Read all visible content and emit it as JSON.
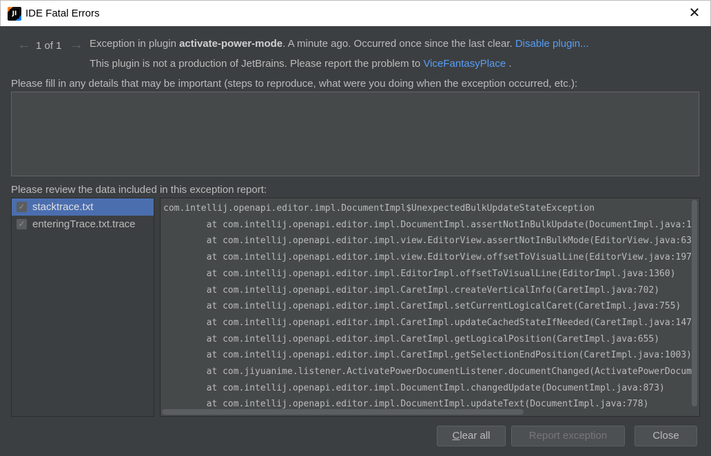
{
  "window": {
    "title": "IDE Fatal Errors",
    "app_icon_text": "JI",
    "close_glyph": "✕"
  },
  "nav": {
    "prev_glyph": "←",
    "next_glyph": "→",
    "counter": "1 of 1"
  },
  "header": {
    "prefix": "Exception in plugin",
    "plugin_name": "activate-power-mode",
    "suffix": ". A minute ago. Occurred once since the last clear.",
    "disable_link": "Disable plugin...",
    "line2_prefix": "This plugin is not a production of JetBrains. Please report the problem to",
    "vendor_link": "ViceFantasyPlace",
    "line2_suffix": "."
  },
  "details": {
    "label": "Please fill in any details that may be important (steps to reproduce, what were you doing when the exception occurred, etc.):",
    "value": ""
  },
  "review": {
    "label": "Please review the data included in this exception report:",
    "files": [
      {
        "name": "stacktrace.txt",
        "checked": true,
        "selected": true
      },
      {
        "name": "enteringTrace.txt.trace",
        "checked": true,
        "selected": false
      }
    ],
    "trace_lines": [
      "com.intellij.openapi.editor.impl.DocumentImpl$UnexpectedBulkUpdateStateException",
      "\tat com.intellij.openapi.editor.impl.DocumentImpl.assertNotInBulkUpdate(DocumentImpl.java:1",
      "\tat com.intellij.openapi.editor.impl.view.EditorView.assertNotInBulkMode(EditorView.java:63",
      "\tat com.intellij.openapi.editor.impl.view.EditorView.offsetToVisualLine(EditorView.java:197",
      "\tat com.intellij.openapi.editor.impl.EditorImpl.offsetToVisualLine(EditorImpl.java:1360)",
      "\tat com.intellij.openapi.editor.impl.CaretImpl.createVerticalInfo(CaretImpl.java:702)",
      "\tat com.intellij.openapi.editor.impl.CaretImpl.setCurrentLogicalCaret(CaretImpl.java:755)",
      "\tat com.intellij.openapi.editor.impl.CaretImpl.updateCachedStateIfNeeded(CaretImpl.java:147",
      "\tat com.intellij.openapi.editor.impl.CaretImpl.getLogicalPosition(CaretImpl.java:655)",
      "\tat com.intellij.openapi.editor.impl.CaretImpl.getSelectionEndPosition(CaretImpl.java:1003)",
      "\tat com.jiyuanime.listener.ActivatePowerDocumentListener.documentChanged(ActivatePowerDocum",
      "\tat com.intellij.openapi.editor.impl.DocumentImpl.changedUpdate(DocumentImpl.java:873)",
      "\tat com.intellij.openapi.editor.impl.DocumentImpl.updateText(DocumentImpl.java:778)"
    ]
  },
  "buttons": {
    "clear_all_mnemonic": "C",
    "clear_all_rest": "lear all",
    "report": "Report exception",
    "close": "Close"
  },
  "colors": {
    "background": "#3c3f41",
    "link": "#589df6",
    "selection": "#4b6eaf"
  }
}
